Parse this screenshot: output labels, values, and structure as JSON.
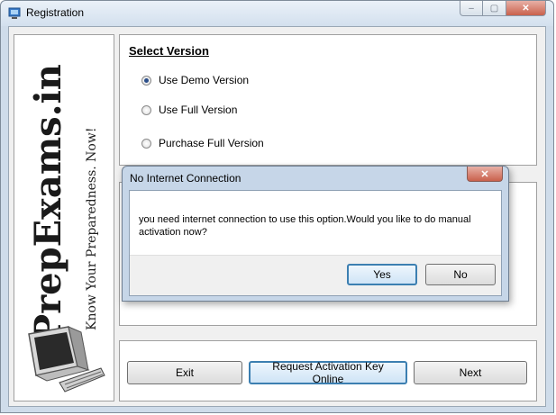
{
  "window": {
    "title": "Registration"
  },
  "branding": {
    "name": "PrepExams.in",
    "tagline": "Know Your Preparedness. Now!"
  },
  "select_version": {
    "title": "Select Version",
    "options": [
      {
        "label": "Use Demo Version",
        "selected": true
      },
      {
        "label": "Use Full Version",
        "selected": false
      },
      {
        "label": "Purchase Full Version",
        "selected": false
      }
    ]
  },
  "footer": {
    "exit_label": "Exit",
    "request_label": "Request Activation Key Online",
    "next_label": "Next"
  },
  "dialog": {
    "title": "No Internet Connection",
    "message": "you need internet connection to use this option.Would you like to do manual activation now?",
    "yes_label": "Yes",
    "no_label": "No",
    "close_glyph": "✕"
  },
  "titlebar": {
    "min_glyph": "–",
    "max_glyph": "▢",
    "close_glyph": "✕"
  }
}
